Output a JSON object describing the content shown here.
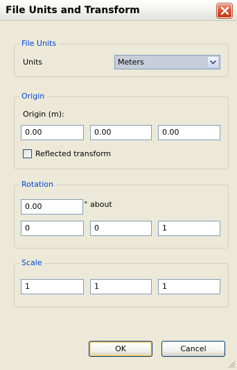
{
  "window": {
    "title": "File Units and Transform"
  },
  "file_units": {
    "legend": "File Units",
    "units_label": "Units",
    "units_value": "Meters"
  },
  "origin": {
    "legend": "Origin",
    "label": "Origin (m):",
    "x": "0.00",
    "y": "0.00",
    "z": "0.00",
    "reflected_label": "Reflected transform",
    "reflected_checked": false
  },
  "rotation": {
    "legend": "Rotation",
    "angle": "0.00",
    "about_label": "° about",
    "axis_x": "0",
    "axis_y": "0",
    "axis_z": "1"
  },
  "scale": {
    "legend": "Scale",
    "x": "1",
    "y": "1",
    "z": "1"
  },
  "buttons": {
    "ok": "OK",
    "cancel": "Cancel"
  },
  "icons": {
    "close": "close-icon",
    "dropdown": "chevron-down-icon",
    "grip": "resize-grip-icon"
  },
  "colors": {
    "legend_text": "#0046d5",
    "close_button": "#d3502f",
    "dialog_bg": "#ece9d8"
  }
}
